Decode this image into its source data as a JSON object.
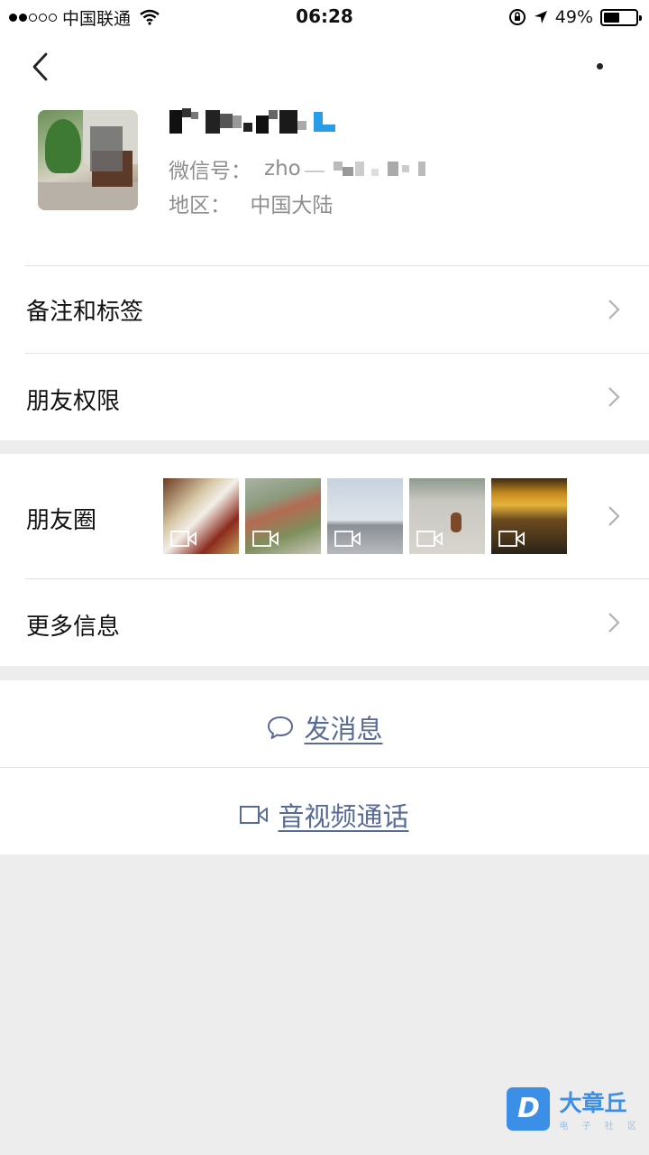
{
  "status_bar": {
    "carrier": "中国联通",
    "time": "06:28",
    "battery_percent": "49%",
    "battery_level": 0.49,
    "icons": [
      "signal-dots",
      "wifi-icon",
      "rotation-lock-icon",
      "location-arrow-icon",
      "battery-icon"
    ]
  },
  "header": {
    "back_icon": "chevron-left-icon",
    "more_icon": "more-dots-icon"
  },
  "profile": {
    "wechat_id_label": "微信号：",
    "wechat_id_value": "zho",
    "region_label": "地区：",
    "region_value": "中国大陆"
  },
  "rows": {
    "remarks_tags": "备注和标签",
    "friend_permissions": "朋友权限",
    "moments": "朋友圈",
    "more_info": "更多信息"
  },
  "actions": {
    "send_message": "发消息",
    "av_call": "音视频通话"
  },
  "watermark": {
    "logo_letter": "D",
    "text": "大章丘",
    "sub": "电 子 社 区"
  },
  "colors": {
    "link": "#576b95",
    "background": "#ededed"
  }
}
